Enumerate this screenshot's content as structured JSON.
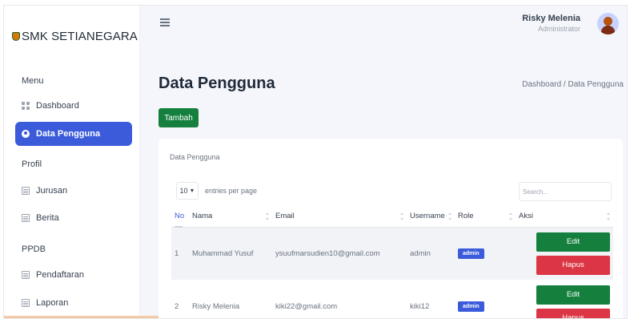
{
  "sidebar": {
    "brand": "SMK SETIANEGARA",
    "sections": {
      "menu": "Menu",
      "profil": "Profil",
      "ppdb": "PPDB"
    },
    "items": [
      {
        "label": "Dashboard",
        "icon": "dashboard-icon"
      },
      {
        "label": "Data Pengguna",
        "icon": "user-circle-icon",
        "active": true
      },
      {
        "label": "Jurusan",
        "icon": "list-icon"
      },
      {
        "label": "Berita",
        "icon": "news-icon"
      },
      {
        "label": "Pendaftaran",
        "icon": "register-icon"
      },
      {
        "label": "Laporan",
        "icon": "report-icon"
      }
    ]
  },
  "header": {
    "user_name": "Risky Melenia",
    "user_role": "Administrator"
  },
  "page": {
    "title": "Data Pengguna",
    "breadcrumb": "Dashboard / Data Pengguna",
    "add_button": "Tambah"
  },
  "card": {
    "title": "Data Pengguna",
    "entries_value": "10",
    "entries_label": "entries per page",
    "search_placeholder": "Search..."
  },
  "table": {
    "columns": [
      "No",
      "Nama",
      "Email",
      "Username",
      "Role",
      "Aksi"
    ],
    "rows": [
      {
        "no": "1",
        "nama": "Muhammad Yusuf",
        "email": "ysuufmarsudien10@gmail.com",
        "username": "admin",
        "role": "admin"
      },
      {
        "no": "2",
        "nama": "Risky Melenia",
        "email": "kiki22@gmail.com",
        "username": "kiki12",
        "role": "admin"
      }
    ],
    "edit_label": "Edit",
    "delete_label": "Hapus"
  },
  "colors": {
    "primary": "#3b5bdb",
    "success": "#15803d",
    "danger": "#dc3545"
  }
}
